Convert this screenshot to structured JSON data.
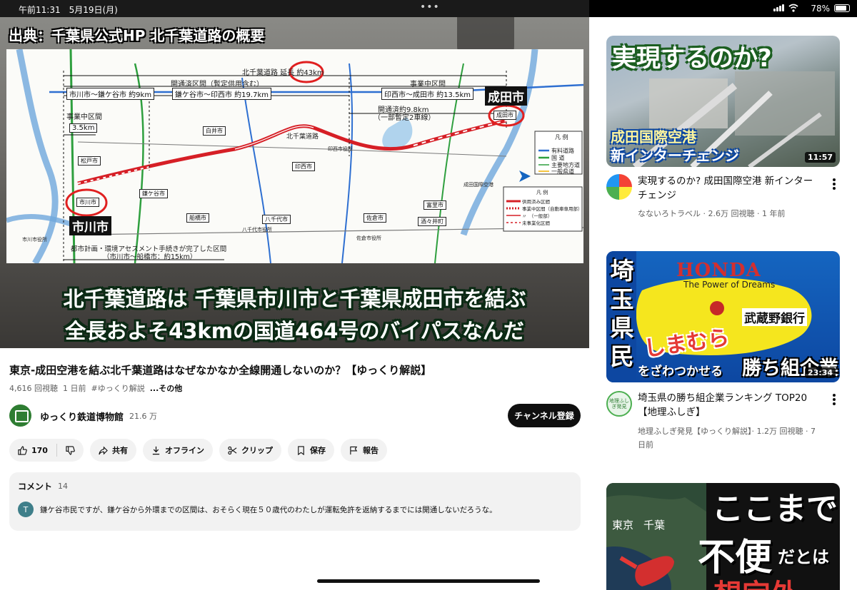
{
  "status": {
    "time": "午前11:31　5月19日(月)",
    "battery": "78%"
  },
  "player": {
    "source_label": "出典：千葉県公式HP 北千葉道路の概要",
    "caption_line1": "北千葉道路は 千葉県市川市と千葉県成田市を結ぶ",
    "caption_line2": "全長およそ43kmの国道464号のバイパスなんだ",
    "map": {
      "total_length": "北千葉道路 延長 約43km",
      "section_open": "開通済区間（暫定供用含む）",
      "seg1": "市川市～鎌ケ谷市 約9km",
      "seg2": "鎌ケ谷市～印西市 約19.7km",
      "seg3_header": "事業中区間",
      "seg3": "印西市～成田市 約13.5km",
      "seg4": "開通済約9.8km",
      "seg4b": "（一部暫定2車線）",
      "left_header": "事業中区間",
      "left_len": "3.5km",
      "narita_label": "成田市",
      "ichikawa_label": "市川市",
      "narita_box": "成田市",
      "ichikawa_box": "市川市",
      "road_name": "北千葉道路",
      "bottom_note": "都市計画・環境アセスメント手続きが完了した区間",
      "bottom_note2": "（市川市～船橋市：約15km）",
      "legend_title": "凡 例",
      "legend_items": [
        "有料道路",
        "国 道",
        "主要地方道",
        "一般県道"
      ],
      "legend2_title": "凡 例",
      "legend2_items": [
        "供用済み区間",
        "事業中区間（自動車専用部）",
        "〃　（一般部）",
        "未事業化区間"
      ],
      "places": [
        "白井市",
        "印西市",
        "佐倉市",
        "船橋市",
        "八千代市",
        "松戸市",
        "鎌ケ谷市",
        "酒々井町",
        "富里市",
        "市川市役所",
        "成田国際空港",
        "八千代市役所",
        "佐倉市役所",
        "印西市役所"
      ]
    }
  },
  "video": {
    "title": "東京-成田空港を結ぶ北千葉道路はなぜなかなか全線開通しないのか？【ゆっくり解説】",
    "views": "4,616 回視聴",
    "age": "1 日前",
    "tag": "#ゆっくり解説",
    "more": "...その他"
  },
  "channel": {
    "name": "ゆっくり鉄道博物館",
    "subs": "21.6 万",
    "subscribe": "チャンネル登録"
  },
  "actions": {
    "likes": "170",
    "share": "共有",
    "offline": "オフライン",
    "clip": "クリップ",
    "save": "保存",
    "report": "報告"
  },
  "comments": {
    "header": "コメント",
    "count": "14",
    "avatar_letter": "T",
    "top_comment": "鎌ケ谷市民ですが、鎌ケ谷から外環までの区間は、おそらく現在５０歳代のわたしが運転免許を返納するまでには開通しないだろうな。"
  },
  "recommendations": [
    {
      "thumb_line1": "実現するのか?",
      "thumb_line2": "成田国際空港",
      "thumb_line3": "新インターチェンジ",
      "duration": "11:57",
      "title": "実現するのか? 成田国際空港 新インターチェンジ",
      "meta": "なないろトラベル · 2.6万 回視聴 · 1 年前"
    },
    {
      "thumb_brand": "HONDA",
      "thumb_slogan": "The Power of Dreams",
      "thumb_bank": "武蔵野銀行",
      "thumb_shimamura": "しまむら",
      "thumb_vertical": "埼玉県民",
      "thumb_bottom1": "をざわつかせる",
      "thumb_bottom2": "勝ち組企業",
      "duration": "23:34",
      "avatar_text": "地理ふしぎ発見",
      "title": "埼玉県の勝ち組企業ランキング TOP20【地理ふしぎ】",
      "meta": "地理ふしぎ発見【ゆっくり解説】· 1.2万 回視聴 · 7 日前"
    },
    {
      "thumb_line1": "ここまで",
      "thumb_line2": "不便",
      "thumb_line3": "だとは",
      "thumb_line4": "想定外",
      "thumb_tokyo": "東京",
      "thumb_chiba": "千葉"
    }
  ]
}
